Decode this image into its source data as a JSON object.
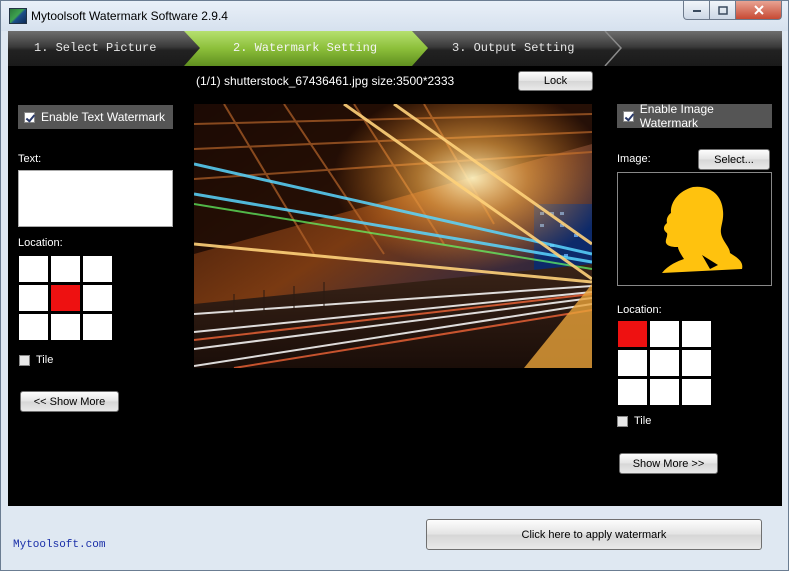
{
  "window": {
    "title": "Mytoolsoft Watermark Software 2.9.4"
  },
  "steps": [
    {
      "label": "1. Select Picture",
      "active": false
    },
    {
      "label": "2. Watermark Setting",
      "active": true
    },
    {
      "label": "3. Output Setting",
      "active": false
    }
  ],
  "fileinfo": {
    "text": "(1/1) shutterstock_67436461.jpg size:3500*2333",
    "lock_label": "Lock"
  },
  "text_watermark": {
    "enable_label": "Enable Text Watermark",
    "enabled": true,
    "text_label": "Text:",
    "text_value": "",
    "location_label": "Location:",
    "selected_cell": 4,
    "tile_label": "Tile",
    "show_more_label": "<< Show More"
  },
  "image_watermark": {
    "enable_label": "Enable Image Watermark",
    "enabled": true,
    "image_label": "Image:",
    "select_label": "Select...",
    "location_label": "Location:",
    "selected_cell": 0,
    "tile_label": "Tile",
    "show_more_label": "Show More >>"
  },
  "footer": {
    "site": "Mytoolsoft.com",
    "apply_label": "Click here to apply watermark"
  },
  "colors": {
    "accent_green": "#8cbf3a",
    "selected_cell": "#ee1111",
    "watermark_yellow": "#ffc20e"
  }
}
